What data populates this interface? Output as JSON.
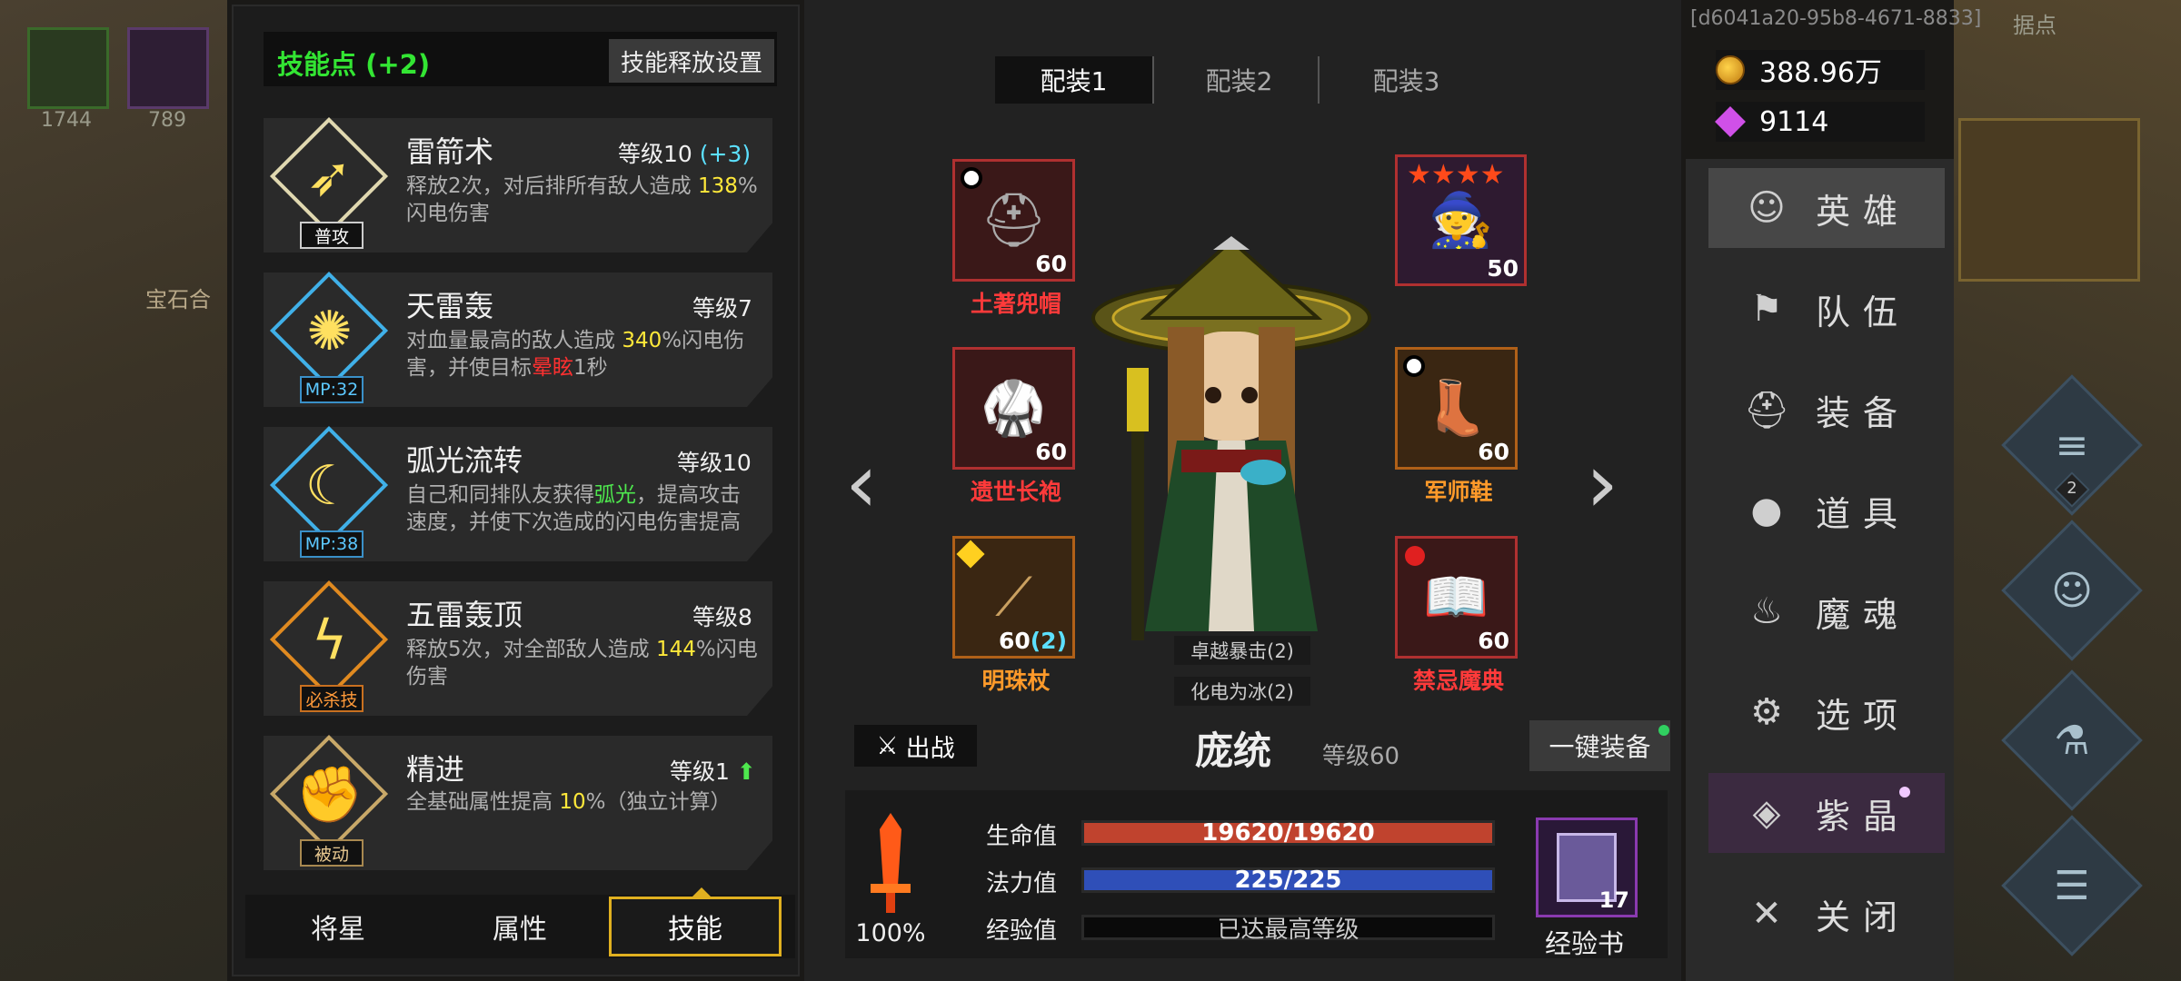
{
  "background": {
    "left_counts": [
      "1744",
      "789"
    ],
    "map_label": "宝石合",
    "right_label": "据点",
    "badge_count": "2"
  },
  "skills_panel": {
    "points_label": "技能点 (+2)",
    "release_settings_button": "技能释放设置",
    "skills": [
      {
        "name": "雷箭术",
        "level": "等级10",
        "bonus": "(+3)",
        "tag": "普攻",
        "desc": [
          "释放2次，对后排所有敌人造成 ",
          "138",
          "%闪电伤害"
        ]
      },
      {
        "name": "天雷轰",
        "level": "等级7",
        "tag": "MP:32",
        "desc": [
          "对血量最高的敌人造成 ",
          "340",
          "%闪电伤害，并使目标",
          "晕眩",
          "1秒"
        ]
      },
      {
        "name": "弧光流转",
        "level": "等级10",
        "tag": "MP:38",
        "desc": [
          "自己和同排队友获得",
          "弧光",
          "，提高攻击速度，并使下次造成的闪电伤害提高"
        ]
      },
      {
        "name": "五雷轰顶",
        "level": "等级8",
        "tag": "必杀技",
        "desc": [
          "释放5次，对全部敌人造成 ",
          "144",
          "%闪电伤害"
        ]
      },
      {
        "name": "精进",
        "level": "等级1",
        "tag": "被动",
        "desc": [
          "全基础属性提高 ",
          "10",
          "%（独立计算）"
        ]
      }
    ],
    "tabs": [
      "将星",
      "属性",
      "技能"
    ],
    "active_tab": "技能"
  },
  "hero_panel": {
    "loadouts": [
      "配装1",
      "配装2",
      "配装3"
    ],
    "active_loadout": "配装1",
    "equipment": [
      {
        "slot": "helmet",
        "name": "土著兜帽",
        "level": "60",
        "name_color": "#ff3a3a"
      },
      {
        "slot": "pet",
        "name": "",
        "level": "50",
        "stars": 4
      },
      {
        "slot": "armor",
        "name": "遗世长袍",
        "level": "60",
        "name_color": "#ff3a3a"
      },
      {
        "slot": "boots",
        "name": "军师鞋",
        "level": "60",
        "name_color": "#ff9a2a"
      },
      {
        "slot": "weapon",
        "name": "明珠杖",
        "level": "60",
        "level_bonus": "(2)",
        "name_color": "#ff9a2a"
      },
      {
        "slot": "book",
        "name": "禁忌魔典",
        "level": "60",
        "name_color": "#ff3a3a"
      }
    ],
    "buffs": [
      "卓越暴击(2)",
      "化电为冰(2)"
    ],
    "deploy_button": "出战",
    "hero_name": "庞统",
    "hero_level": "等级60",
    "auto_equip_button": "一键装备",
    "power_percent": "100%",
    "stats": [
      {
        "label": "生命值",
        "value": "19620/19620",
        "fill": 1.0,
        "color": "#c0432e"
      },
      {
        "label": "法力值",
        "value": "225/225",
        "fill": 1.0,
        "color": "#2f4fb8"
      },
      {
        "label": "经验值",
        "value": "已达最高等级",
        "fill": 0.0,
        "color": "#3a7a3a"
      }
    ],
    "exp_book": {
      "label": "经验书",
      "count": "17"
    }
  },
  "right_panel": {
    "id_label": "[d6041a20-95b8-4671-8833]",
    "gold": "388.96万",
    "gems": "9114",
    "menu": [
      {
        "label": "英雄",
        "icon": "heroes-icon"
      },
      {
        "label": "队伍",
        "icon": "flag-icon"
      },
      {
        "label": "装备",
        "icon": "helmet-icon"
      },
      {
        "label": "道具",
        "icon": "bag-icon"
      },
      {
        "label": "魔魂",
        "icon": "flame-icon"
      },
      {
        "label": "选项",
        "icon": "gear-icon"
      },
      {
        "label": "紫晶",
        "icon": "crystal-icon"
      },
      {
        "label": "关闭",
        "icon": "close-icon"
      }
    ],
    "active_menu": "英雄"
  }
}
